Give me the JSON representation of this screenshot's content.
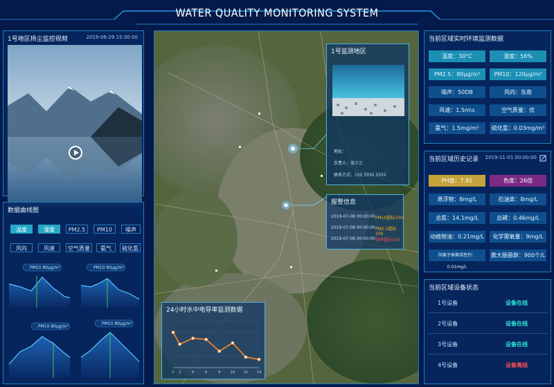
{
  "title": "WATER QUALITY MONITORING SYSTEM",
  "video_panel": {
    "title": "1号地区扬尘监控视频",
    "datetime": "2019-06-29 15:30:00"
  },
  "curve_panel": {
    "title": "数据曲线图",
    "tags": [
      "温度",
      "湿度",
      "PM2.5",
      "PM10",
      "噪声",
      "风向",
      "风速",
      "空气质量",
      "氨气",
      "硫化氢"
    ],
    "tooltip": "PM10 80μg/m³"
  },
  "map": {
    "popup_area": {
      "title": "1号监测地区",
      "lines": [
        "地址：",
        "负责人：张三三",
        "联系方式：155 5555 5555"
      ]
    },
    "popup_alarm": {
      "title": "报警信息",
      "rows": [
        {
          "time": "2019-07-08 00:00:00",
          "desc": "PM10超标100"
        },
        {
          "time": "2019-07-08 00:00:00",
          "desc": "PM2.5超标100"
        },
        {
          "time": "2019-07-08 00:00:00",
          "desc": "噪声超标100"
        }
      ]
    },
    "chart_title": "24小时水中电导率监测数据"
  },
  "chart_data": {
    "type": "line",
    "x": [
      1,
      2,
      4,
      6,
      8,
      10,
      12,
      14
    ],
    "series": [
      {
        "values": [
          6,
          4,
          5,
          4.8,
          2.8,
          4.2,
          1.8,
          1.4
        ]
      }
    ],
    "ylim": [
      0,
      8
    ]
  },
  "env_panel": {
    "title": "当前区域实时环境监测数据",
    "items": [
      {
        "label": "温度：30°C",
        "style": "teal"
      },
      {
        "label": "湿度：56%",
        "style": "teal"
      },
      {
        "label": "PM2.5：80μg/m³",
        "style": "teal"
      },
      {
        "label": "PM10：120μg/m³",
        "style": "teal"
      },
      {
        "label": "噪声：50DB",
        "style": "plain"
      },
      {
        "label": "风向：东南",
        "style": "plain"
      },
      {
        "label": "风速：1.5m\\s",
        "style": "plain"
      },
      {
        "label": "空气质量：优",
        "style": "plain"
      },
      {
        "label": "氨气：1.5mg/m³",
        "style": "plain"
      },
      {
        "label": "硫化氢：0.03mg/m³",
        "style": "plain"
      }
    ]
  },
  "history_panel": {
    "title": "当前区域历史记录",
    "datetime": "2019-11-01 00:00:00",
    "items": [
      {
        "label": "PH值：7.91",
        "style": "gold"
      },
      {
        "label": "色度：26倍",
        "style": "purple"
      },
      {
        "label": "悬浮物：8mg/L",
        "style": "plain"
      },
      {
        "label": "石油类：8mg/L",
        "style": "plain"
      },
      {
        "label": "总氮：14.1mg/L",
        "style": "plain"
      },
      {
        "label": "总磷：0.46mg/L",
        "style": "plain"
      },
      {
        "label": "动植物油：0.21mg/L",
        "style": "plain"
      },
      {
        "label": "化学需氧量：9mg/L",
        "style": "plain"
      },
      {
        "label": "阴离子表面活性剂：0.01mg/L",
        "style": "plain"
      },
      {
        "label": "粪大肠菌群：900个/L",
        "style": "plain"
      }
    ]
  },
  "device_panel": {
    "title": "当前区域设备状态",
    "devices": [
      {
        "name": "1号设备",
        "status": "设备在线"
      },
      {
        "name": "2号设备",
        "status": "设备在线"
      },
      {
        "name": "3号设备",
        "status": "设备在线"
      },
      {
        "name": "4号设备",
        "status": "设备离线"
      }
    ]
  },
  "colors": {
    "online": "#2ee2d5",
    "offline": "#ff5050",
    "accent": "#26a8c7"
  }
}
